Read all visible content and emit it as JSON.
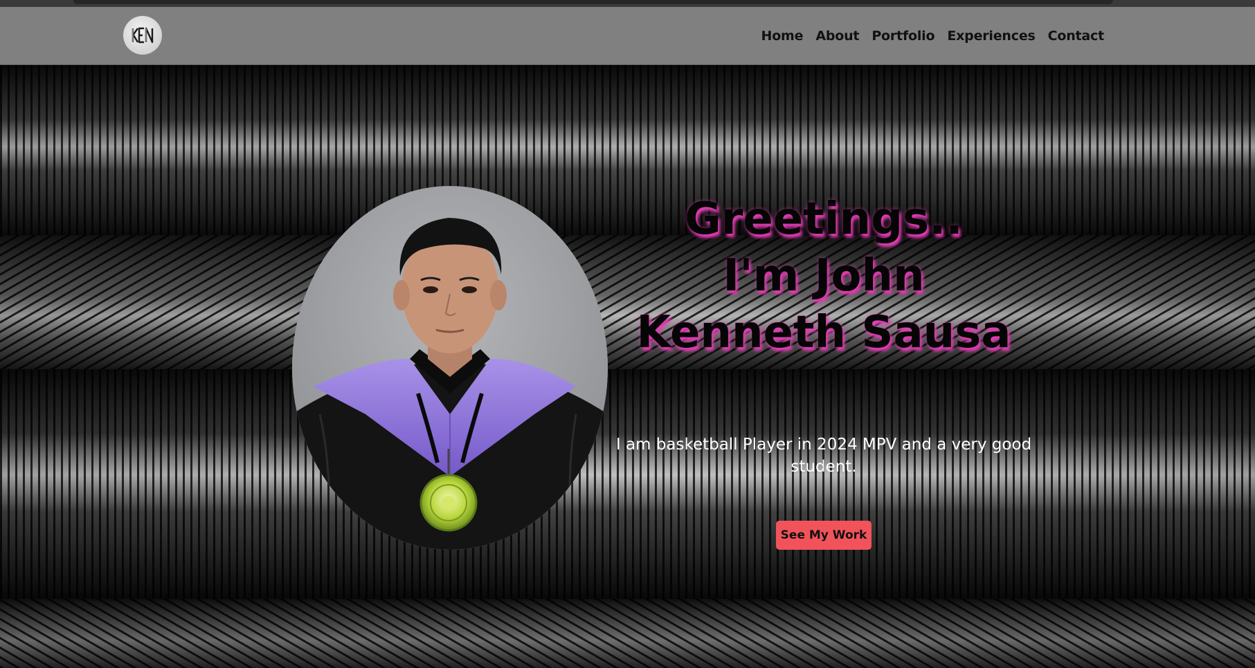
{
  "brand": {
    "logo_text": "KEN"
  },
  "nav": {
    "items": [
      {
        "label": "Home"
      },
      {
        "label": "About"
      },
      {
        "label": "Portfolio"
      },
      {
        "label": "Experiences"
      },
      {
        "label": "Contact"
      }
    ]
  },
  "hero": {
    "headline_line1": "Greetings..",
    "headline_line2": "I'm John",
    "headline_line3": "Kenneth Sausa",
    "tagline": "I am basketball Player in 2024 MPV and a very good student.",
    "cta_label": "See My Work",
    "portrait_alt": "Graduation portrait with purple hood and medal"
  },
  "colors": {
    "navbar_bg": "#808080",
    "headline_shadow": "#e43bb4",
    "cta_bg": "#f2535b",
    "tagline_text": "#ffffff"
  }
}
